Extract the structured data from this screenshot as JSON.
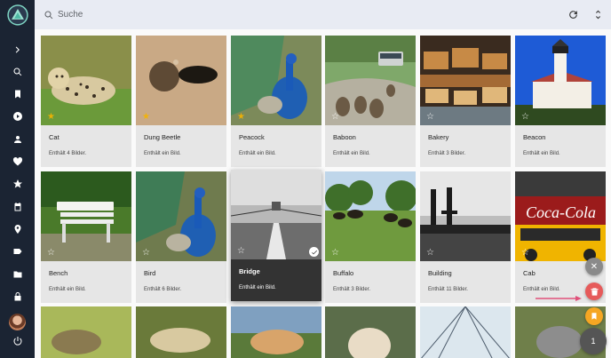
{
  "search": {
    "placeholder": "Suche"
  },
  "sidebar": {
    "items": [
      {
        "icon": "chevron-right-icon"
      },
      {
        "icon": "search-icon"
      },
      {
        "icon": "bookmark-icon"
      },
      {
        "icon": "play-icon"
      },
      {
        "icon": "person-icon"
      },
      {
        "icon": "heart-icon"
      },
      {
        "icon": "star-icon"
      },
      {
        "icon": "calendar-icon"
      },
      {
        "icon": "place-icon"
      },
      {
        "icon": "label-icon"
      },
      {
        "icon": "folder-icon"
      },
      {
        "icon": "lock-icon"
      }
    ]
  },
  "cards": [
    {
      "title": "Cat",
      "sub": "Enthält 4 Bilder.",
      "fav": true
    },
    {
      "title": "Dung Beetle",
      "sub": "Enthält ein Bild.",
      "fav": true
    },
    {
      "title": "Peacock",
      "sub": "Enthält ein Bild.",
      "fav": true
    },
    {
      "title": "Baboon",
      "sub": "Enthält ein Bild.",
      "fav": false
    },
    {
      "title": "Bakery",
      "sub": "Enthält 3 Bilder.",
      "fav": false
    },
    {
      "title": "Beacon",
      "sub": "Enthält ein Bild.",
      "fav": false
    },
    {
      "title": "Bench",
      "sub": "Enthält ein Bild.",
      "fav": false
    },
    {
      "title": "Bird",
      "sub": "Enthält 6 Bilder.",
      "fav": false
    },
    {
      "title": "Bridge",
      "sub": "Enthält ein Bild.",
      "fav": false,
      "selected": true
    },
    {
      "title": "Buffalo",
      "sub": "Enthält 3 Bilder.",
      "fav": false
    },
    {
      "title": "Building",
      "sub": "Enthält 11 Bilder.",
      "fav": false
    },
    {
      "title": "Cab",
      "sub": "Enthält ein Bild.",
      "fav": false
    }
  ],
  "actions": {
    "count": "1",
    "close": "✕"
  },
  "colors": {
    "sidebar": "#1b2433",
    "topbar": "#e8ebf3",
    "accent": "#e65a5a",
    "album": "#f5a623"
  }
}
